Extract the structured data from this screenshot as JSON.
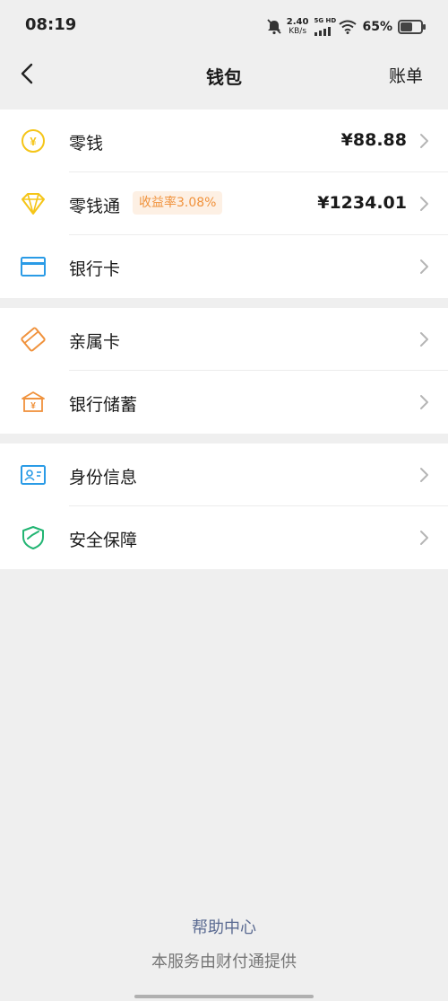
{
  "status_bar": {
    "time": "08:19",
    "net_speed_value": "2.40",
    "net_speed_unit": "KB/s",
    "network": "5G HD",
    "battery": "65%"
  },
  "nav": {
    "title": "钱包",
    "right_action": "账单"
  },
  "groups": [
    [
      {
        "label": "零钱",
        "value": "¥88.88",
        "icon": "coin-yen-icon"
      },
      {
        "label": "零钱通",
        "tag": "收益率3.08%",
        "value": "¥1234.01",
        "icon": "diamond-icon"
      },
      {
        "label": "银行卡",
        "icon": "bank-card-icon"
      }
    ],
    [
      {
        "label": "亲属卡",
        "icon": "family-card-icon"
      },
      {
        "label": "银行储蓄",
        "icon": "bank-building-icon"
      }
    ],
    [
      {
        "label": "身份信息",
        "icon": "id-card-icon"
      },
      {
        "label": "安全保障",
        "icon": "shield-icon"
      }
    ]
  ],
  "footer": {
    "help_link": "帮助中心",
    "provider_note": "本服务由财付通提供"
  },
  "colors": {
    "yellow": "#f5c518",
    "blue": "#2a9be6",
    "orange": "#f0923c",
    "green": "#22b573",
    "link": "#5b6b92"
  }
}
